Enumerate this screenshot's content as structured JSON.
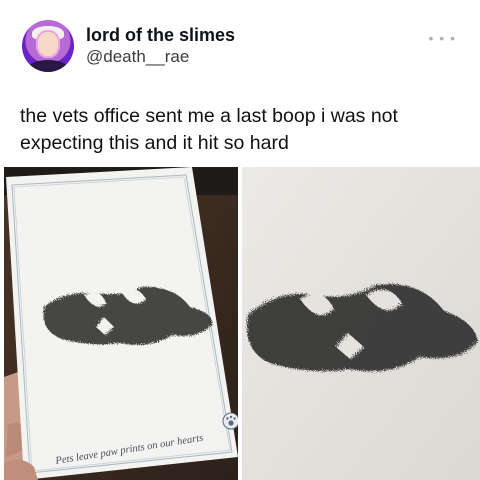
{
  "user": {
    "display_name": "lord of the slimes",
    "handle": "@death__rae"
  },
  "more_icon": "more-horizontal-icon",
  "tweet": {
    "text": "the vets office sent me a last boop i was not expecting this and it hit so hard"
  },
  "media": {
    "left_photo": {
      "card_caption": "Pets leave paw prints on our hearts"
    },
    "right_photo": {}
  },
  "colors": {
    "text": "#0f1419",
    "secondary_text": "#3c3c3c",
    "avatar_ring": "#6a22c9"
  }
}
